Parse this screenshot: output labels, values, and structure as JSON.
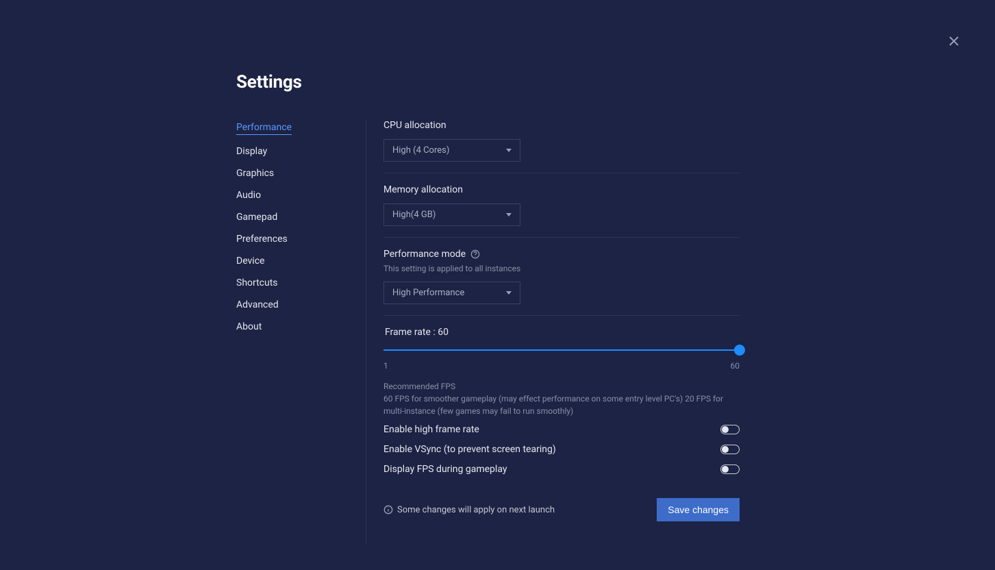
{
  "title": "Settings",
  "sidebar": {
    "items": [
      "Performance",
      "Display",
      "Graphics",
      "Audio",
      "Gamepad",
      "Preferences",
      "Device",
      "Shortcuts",
      "Advanced",
      "About"
    ],
    "active_index": 0
  },
  "cpu": {
    "label": "CPU allocation",
    "value": "High (4 Cores)"
  },
  "memory": {
    "label": "Memory allocation",
    "value": "High(4 GB)"
  },
  "perf_mode": {
    "label": "Performance mode",
    "helper": "This setting is applied to all instances",
    "value": "High Performance"
  },
  "frame": {
    "label_prefix": "Frame rate : ",
    "value": "60",
    "min": "1",
    "max": "60",
    "rec_title": "Recommended FPS",
    "rec_text": "60 FPS for smoother gameplay (may effect performance on some entry level PC's) 20 FPS for multi-instance (few games may fail to run smoothly)"
  },
  "toggles": {
    "high_fps": "Enable high frame rate",
    "vsync": "Enable VSync (to prevent screen tearing)",
    "display_fps": "Display FPS during gameplay"
  },
  "footer": {
    "notice": "Some changes will apply on next launch",
    "save": "Save changes"
  }
}
